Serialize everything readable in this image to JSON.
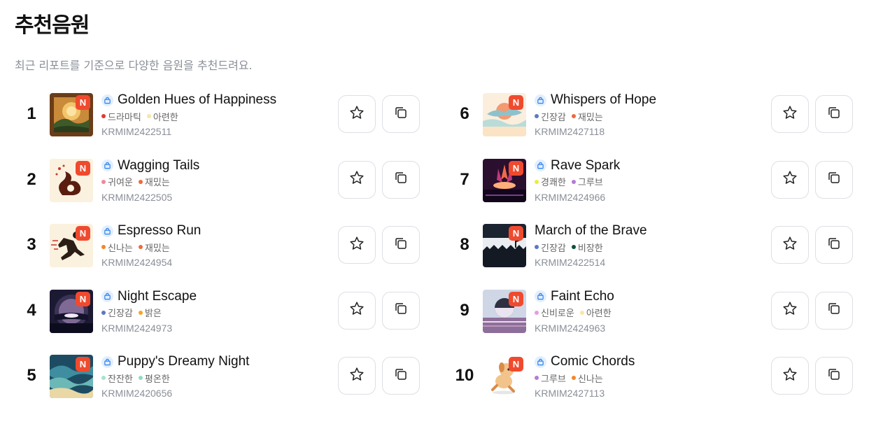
{
  "header": {
    "title": "추천음원",
    "subtitle": "최근 리포트를 기준으로 다양한 음원을 추천드려요."
  },
  "badge_label": "N",
  "colors": {
    "badge": "#f04a2e",
    "bag_icon_bg": "#e1effe",
    "bag_icon": "#2f80ed",
    "subtitle": "#8a8f98"
  },
  "tracks": [
    {
      "rank": "1",
      "title": "Golden Hues of Happiness",
      "tags": [
        {
          "label": "드라마틱",
          "color": "#e23b2e"
        },
        {
          "label": "아련한",
          "color": "#f7e6a6"
        }
      ],
      "code": "KRMIM2422511",
      "show_bag": true,
      "art": "golden"
    },
    {
      "rank": "2",
      "title": "Wagging Tails",
      "tags": [
        {
          "label": "귀여운",
          "color": "#f2889b"
        },
        {
          "label": "재밌는",
          "color": "#ee6a3c"
        }
      ],
      "code": "KRMIM2422505",
      "show_bag": true,
      "art": "wagging"
    },
    {
      "rank": "3",
      "title": "Espresso Run",
      "tags": [
        {
          "label": "신나는",
          "color": "#f4862a"
        },
        {
          "label": "재밌는",
          "color": "#ee6a3c"
        }
      ],
      "code": "KRMIM2424954",
      "show_bag": true,
      "art": "espresso"
    },
    {
      "rank": "4",
      "title": "Night Escape",
      "tags": [
        {
          "label": "긴장감",
          "color": "#5b78c7"
        },
        {
          "label": "밝은",
          "color": "#f5a623"
        }
      ],
      "code": "KRMIM2424973",
      "show_bag": true,
      "art": "night"
    },
    {
      "rank": "5",
      "title": "Puppy's Dreamy Night",
      "tags": [
        {
          "label": "잔잔한",
          "color": "#a8e0d3"
        },
        {
          "label": "평온한",
          "color": "#8fdcc4"
        }
      ],
      "code": "KRMIM2420656",
      "show_bag": true,
      "art": "puppy"
    },
    {
      "rank": "6",
      "title": "Whispers of Hope",
      "tags": [
        {
          "label": "긴장감",
          "color": "#5b78c7"
        },
        {
          "label": "재밌는",
          "color": "#ee6a3c"
        }
      ],
      "code": "KRMIM2427118",
      "show_bag": true,
      "art": "whispers"
    },
    {
      "rank": "7",
      "title": "Rave Spark",
      "tags": [
        {
          "label": "경쾌한",
          "color": "#e7ef3a"
        },
        {
          "label": "그루브",
          "color": "#b57ad6"
        }
      ],
      "code": "KRMIM2424966",
      "show_bag": true,
      "art": "rave"
    },
    {
      "rank": "8",
      "title": "March of the Brave",
      "tags": [
        {
          "label": "긴장감",
          "color": "#5b78c7"
        },
        {
          "label": "비장한",
          "color": "#0f4f3a"
        }
      ],
      "code": "KRMIM2422514",
      "show_bag": false,
      "art": "march"
    },
    {
      "rank": "9",
      "title": "Faint Echo",
      "tags": [
        {
          "label": "신비로운",
          "color": "#e59be8"
        },
        {
          "label": "아련한",
          "color": "#f7e6a6"
        }
      ],
      "code": "KRMIM2424963",
      "show_bag": true,
      "art": "faint"
    },
    {
      "rank": "10",
      "title": "Comic Chords",
      "tags": [
        {
          "label": "그루브",
          "color": "#b57ad6"
        },
        {
          "label": "신나는",
          "color": "#f4862a"
        }
      ],
      "code": "KRMIM2427113",
      "show_bag": true,
      "art": "comic"
    }
  ]
}
